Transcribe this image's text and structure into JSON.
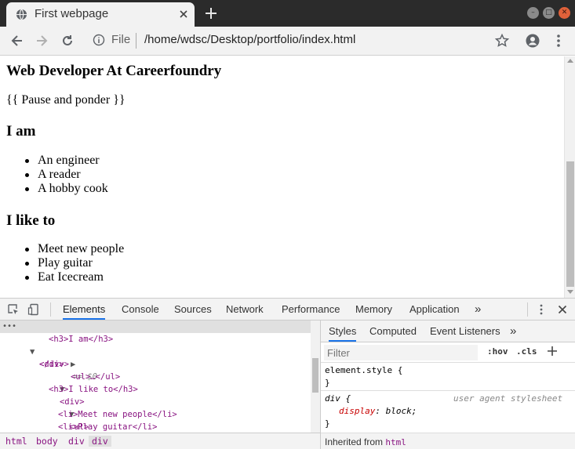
{
  "browser": {
    "tab_title": "First webpage",
    "address_prefix": "File",
    "url": "/home/wdsc/Desktop/portfolio/index.html",
    "window_buttons": [
      "–",
      "□",
      "✕"
    ]
  },
  "page": {
    "heading": "Web Developer At Careerfoundry",
    "paragraph": "{{ Pause and ponder }}",
    "section1_heading": "I am",
    "section1_items": [
      "An engineer",
      "A reader",
      "A hobby cook"
    ],
    "section2_heading": "I like to",
    "section2_items": [
      "Meet new people",
      "Play guitar",
      "Eat Icecream"
    ]
  },
  "devtools": {
    "tabs": [
      "Elements",
      "Console",
      "Sources",
      "Network",
      "Performance",
      "Memory",
      "Application"
    ],
    "more": "»",
    "elements_lines": [
      {
        "indent": 4,
        "open": "<div>",
        "suffix": " == $0",
        "selected": true,
        "arrow": "down"
      },
      {
        "indent": 6,
        "html": "<h3>I am</h3>"
      },
      {
        "indent": 6,
        "html": "<ul>…</ul>",
        "arrow": "right"
      },
      {
        "indent": 5,
        "html": "</div>"
      },
      {
        "indent": 5,
        "html": "<div>",
        "arrow": "down"
      },
      {
        "indent": 6,
        "html": "<h3>I like to</h3>"
      },
      {
        "indent": 6,
        "html": "<ul>",
        "arrow": "down"
      },
      {
        "indent": 7,
        "html": "<li>Meet new people</li>"
      },
      {
        "indent": 7,
        "html": "<li>Play guitar</li>"
      }
    ],
    "breadcrumbs": [
      "html",
      "body",
      "div",
      "div"
    ],
    "styles_tabs": [
      "Styles",
      "Computed",
      "Event Listeners"
    ],
    "filter_placeholder": "Filter",
    "hov_label": ":hov",
    "cls_label": ".cls",
    "element_style_selector": "element.style {",
    "close_brace": "}",
    "ua_selector": "div {",
    "ua_source": "user agent stylesheet",
    "ua_property": "display",
    "ua_value": "block;",
    "inherited_label": "Inherited from",
    "inherited_from": "html"
  }
}
